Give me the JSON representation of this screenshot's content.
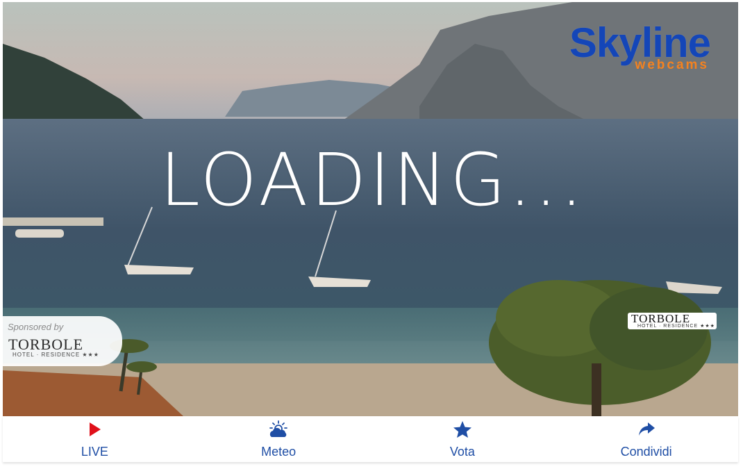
{
  "brand": {
    "name": "Skyline",
    "tagline": "webcams"
  },
  "loading_text": "LOADING...",
  "sponsor": {
    "label": "Sponsored by",
    "name": "TORBOLE",
    "subtitle": "HOTEL · RESIDENCE ★★★"
  },
  "watermark": {
    "name": "TORBOLE",
    "subtitle": "HOTEL · RESIDENCE ★★★"
  },
  "toolbar": [
    {
      "label": "LIVE",
      "icon": "play-icon"
    },
    {
      "label": "Meteo",
      "icon": "weather-icon"
    },
    {
      "label": "Vota",
      "icon": "star-icon"
    },
    {
      "label": "Condividi",
      "icon": "share-icon"
    }
  ],
  "colors": {
    "brand_blue": "#1446b8",
    "brand_orange": "#f5821f",
    "live_red": "#e0101a",
    "toolbar_blue": "#1f4ea5"
  }
}
